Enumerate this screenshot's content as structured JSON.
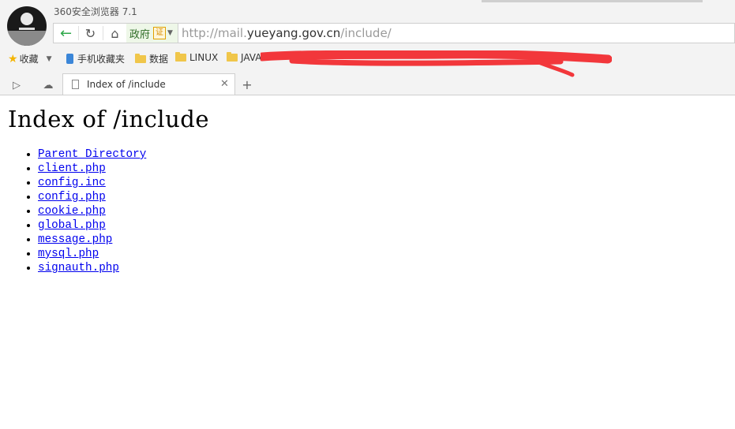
{
  "browser": {
    "app_title": "360安全浏览器 7.1",
    "gov_label": "政府",
    "cert_label": "证",
    "url_prefix": "http://mail.",
    "url_domain": "yueyang.gov.cn",
    "url_path": "/include/"
  },
  "bookmarks": [
    {
      "label": "收藏",
      "icon": "star-icon"
    },
    {
      "label": "手机收藏夹",
      "icon": "phone-icon"
    },
    {
      "label": "数据",
      "icon": "folder-icon"
    },
    {
      "label": "LINUX",
      "icon": "folder-icon"
    },
    {
      "label": "JAVA",
      "icon": "folder-icon"
    }
  ],
  "tab": {
    "title": "Index of /include"
  },
  "page": {
    "heading": "Index of /include",
    "links": [
      "Parent Directory",
      "client.php",
      "config.inc",
      "config.php",
      "cookie.php",
      "global.php",
      "message.php",
      "mysql.php",
      "signauth.php"
    ]
  },
  "colors": {
    "redaction": "#f2373b",
    "link": "#0000ee",
    "gov_green": "#2d6b25"
  }
}
